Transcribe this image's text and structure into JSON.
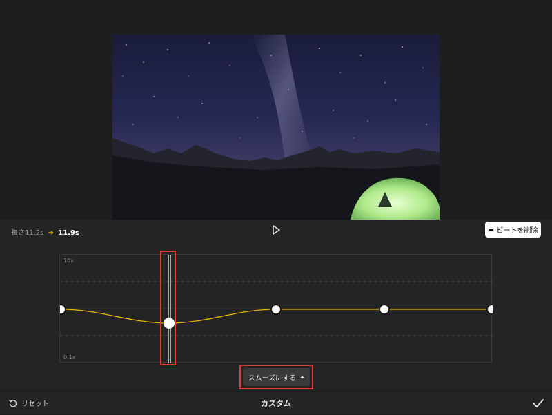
{
  "preview": {
    "image_description": "starry night sky, milky way over mountains with a glowing tent"
  },
  "duration": {
    "original": "長さ11.2s",
    "new": "11.9s"
  },
  "actions": {
    "remove_beat": "ビートを削除",
    "smooth": "スムーズにする",
    "reset": "リセット",
    "title": "カスタム"
  },
  "graph": {
    "label_max": "10x",
    "label_min": "0.1x",
    "speed_points": [
      1,
      0.6,
      1,
      1,
      1
    ],
    "selected_index": 1
  },
  "colors": {
    "accent": "#e5b800",
    "highlight": "#e23a3a"
  }
}
